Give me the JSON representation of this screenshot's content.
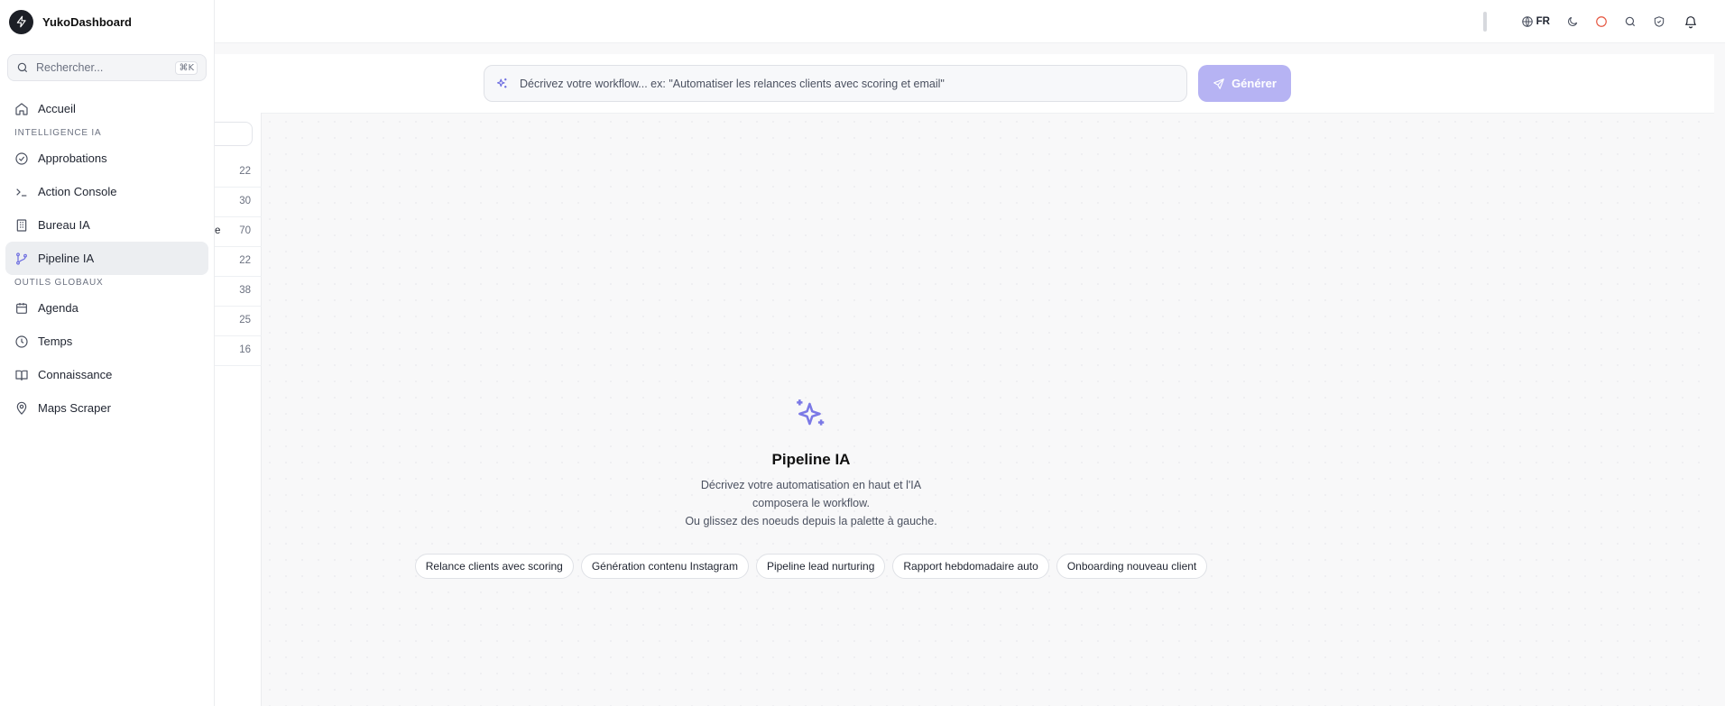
{
  "app": {
    "name": "YukoDashboard"
  },
  "search": {
    "placeholder": "Rechercher...",
    "shortcut": "⌘K"
  },
  "nav": {
    "home": "Accueil",
    "section_ai": "INTELLIGENCE IA",
    "ai_items": [
      {
        "label": "Approbations",
        "icon": "check-circle-icon"
      },
      {
        "label": "Action Console",
        "icon": "terminal-icon"
      },
      {
        "label": "Bureau IA",
        "icon": "building-icon"
      },
      {
        "label": "Pipeline IA",
        "icon": "git-branch-icon",
        "active": true
      }
    ],
    "section_tools": "OUTILS GLOBAUX",
    "tool_items": [
      {
        "label": "Agenda",
        "icon": "calendar-icon"
      },
      {
        "label": "Temps",
        "icon": "clock-icon"
      },
      {
        "label": "Connaissance",
        "icon": "book-icon"
      },
      {
        "label": "Maps Scraper",
        "icon": "map-pin-icon"
      }
    ]
  },
  "palette": {
    "counts": [
      "22",
      "30",
      "70",
      "22",
      "38",
      "25",
      "16"
    ],
    "fragment": "e"
  },
  "topbar": {
    "language": "FR"
  },
  "prompt": {
    "placeholder": "Décrivez votre workflow... ex: \"Automatiser les relances clients avec scoring et email\"",
    "generate_label": "Générer"
  },
  "empty_state": {
    "title": "Pipeline IA",
    "line1": "Décrivez votre automatisation en haut et l'IA composera le workflow.",
    "line2": "Ou glissez des noeuds depuis la palette à gauche.",
    "suggestions": [
      "Relance clients avec scoring",
      "Génération contenu Instagram",
      "Pipeline lead nurturing",
      "Rapport hebdomadaire auto",
      "Onboarding nouveau client"
    ]
  },
  "colors": {
    "accent": "#6c6ce0",
    "generate_button": "#b6b3f3",
    "status_ring": "#e5533d"
  }
}
